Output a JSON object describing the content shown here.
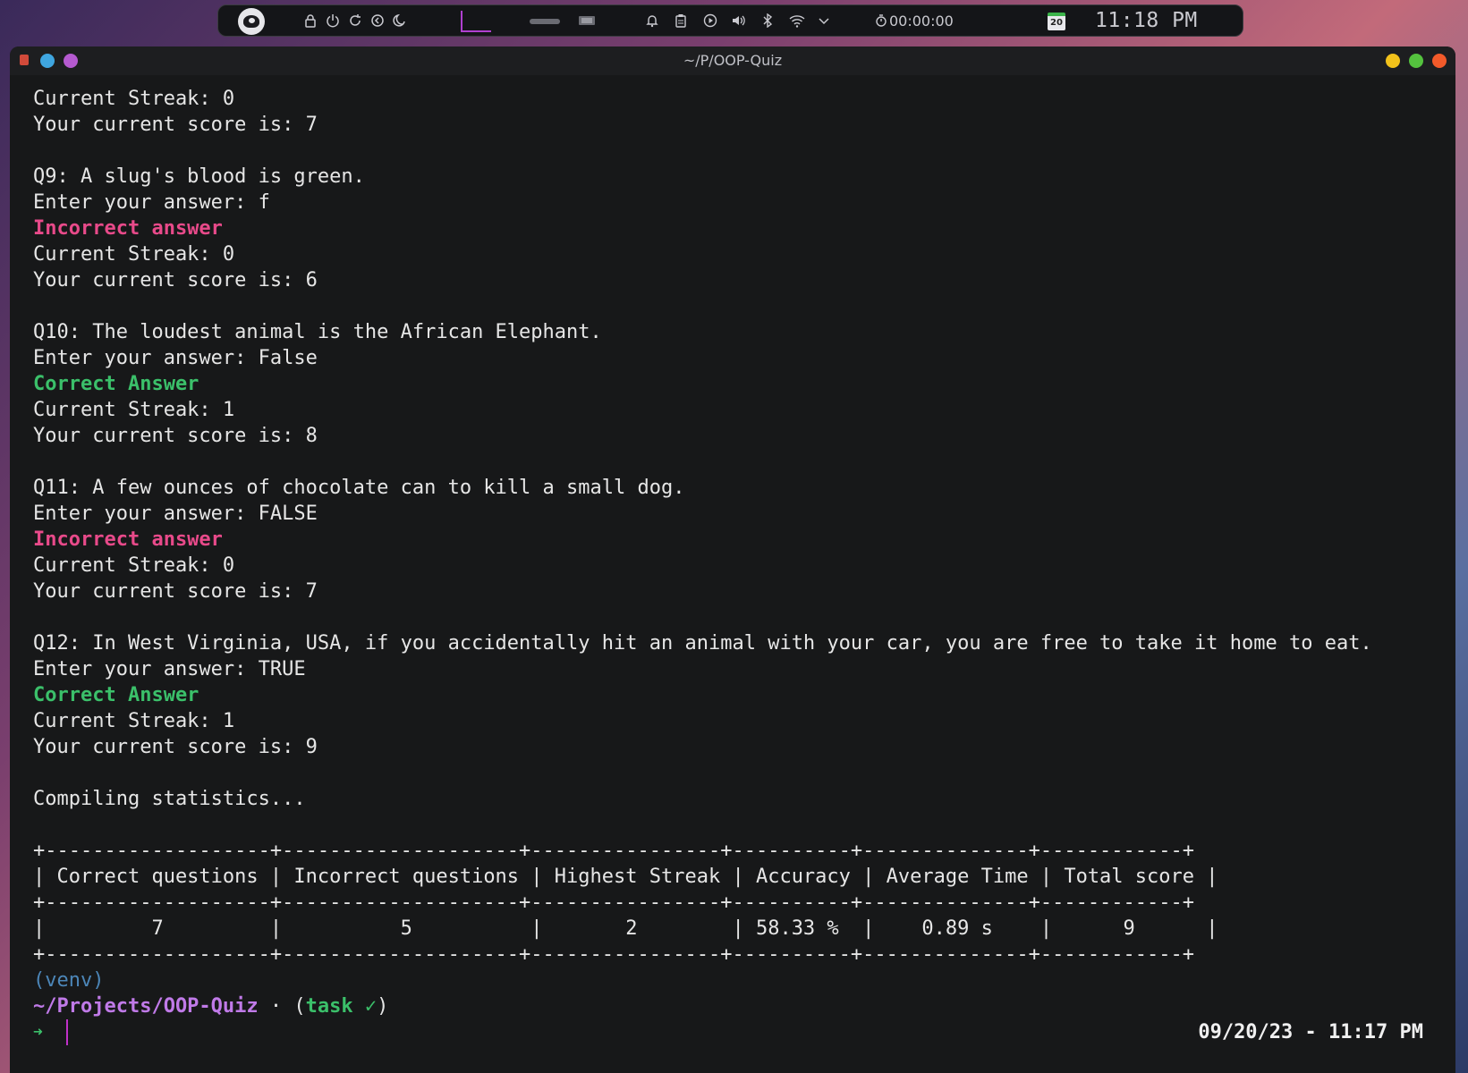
{
  "panel": {
    "timer": "00:00:00",
    "calendar_day": "20",
    "clock": "11:18 PM"
  },
  "window": {
    "title": "~/P/OOP-Quiz"
  },
  "terminal": {
    "lines": [
      {
        "text": "Current Streak: 0",
        "style": ""
      },
      {
        "text": "Your current score is: 7",
        "style": ""
      },
      {
        "text": "",
        "style": ""
      },
      {
        "text": "Q9: A slug's blood is green.",
        "style": ""
      },
      {
        "text": "Enter your answer: f",
        "style": ""
      },
      {
        "text": "Incorrect answer",
        "style": "pink"
      },
      {
        "text": "Current Streak: 0",
        "style": ""
      },
      {
        "text": "Your current score is: 6",
        "style": ""
      },
      {
        "text": "",
        "style": ""
      },
      {
        "text": "Q10: The loudest animal is the African Elephant.",
        "style": ""
      },
      {
        "text": "Enter your answer: False",
        "style": ""
      },
      {
        "text": "Correct Answer",
        "style": "green"
      },
      {
        "text": "Current Streak: 1",
        "style": ""
      },
      {
        "text": "Your current score is: 8",
        "style": ""
      },
      {
        "text": "",
        "style": ""
      },
      {
        "text": "Q11: A few ounces of chocolate can to kill a small dog.",
        "style": ""
      },
      {
        "text": "Enter your answer: FALSE",
        "style": ""
      },
      {
        "text": "Incorrect answer",
        "style": "pink"
      },
      {
        "text": "Current Streak: 0",
        "style": ""
      },
      {
        "text": "Your current score is: 7",
        "style": ""
      },
      {
        "text": "",
        "style": ""
      },
      {
        "text": "Q12: In West Virginia, USA, if you accidentally hit an animal with your car, you are free to take it home to eat.",
        "style": ""
      },
      {
        "text": "Enter your answer: TRUE",
        "style": ""
      },
      {
        "text": "Correct Answer",
        "style": "green"
      },
      {
        "text": "Current Streak: 1",
        "style": ""
      },
      {
        "text": "Your current score is: 9",
        "style": ""
      },
      {
        "text": "",
        "style": ""
      },
      {
        "text": "Compiling statistics...",
        "style": ""
      },
      {
        "text": "",
        "style": ""
      },
      {
        "text": "+-------------------+--------------------+----------------+----------+--------------+------------+",
        "style": ""
      },
      {
        "text": "| Correct questions | Incorrect questions | Highest Streak | Accuracy | Average Time | Total score |",
        "style": ""
      },
      {
        "text": "+-------------------+--------------------+----------------+----------+--------------+------------+",
        "style": ""
      },
      {
        "text": "|         7         |          5          |       2        | 58.33 %  |    0.89 s    |      9      |",
        "style": ""
      },
      {
        "text": "+-------------------+--------------------+----------------+----------+--------------+------------+",
        "style": ""
      }
    ],
    "venv": "(venv)",
    "prompt_path": "~/Projects/OOP-Quiz",
    "prompt_sep": " · (",
    "prompt_branch": "task ✓",
    "prompt_close": ")",
    "prompt_arrow": "➜",
    "right_prompt": "09/20/23 - 11:17 PM"
  },
  "colors": {
    "incorrect": "#e84a8a",
    "correct": "#3bc06a",
    "venv": "#4c86b8",
    "path": "#c07ae8"
  }
}
